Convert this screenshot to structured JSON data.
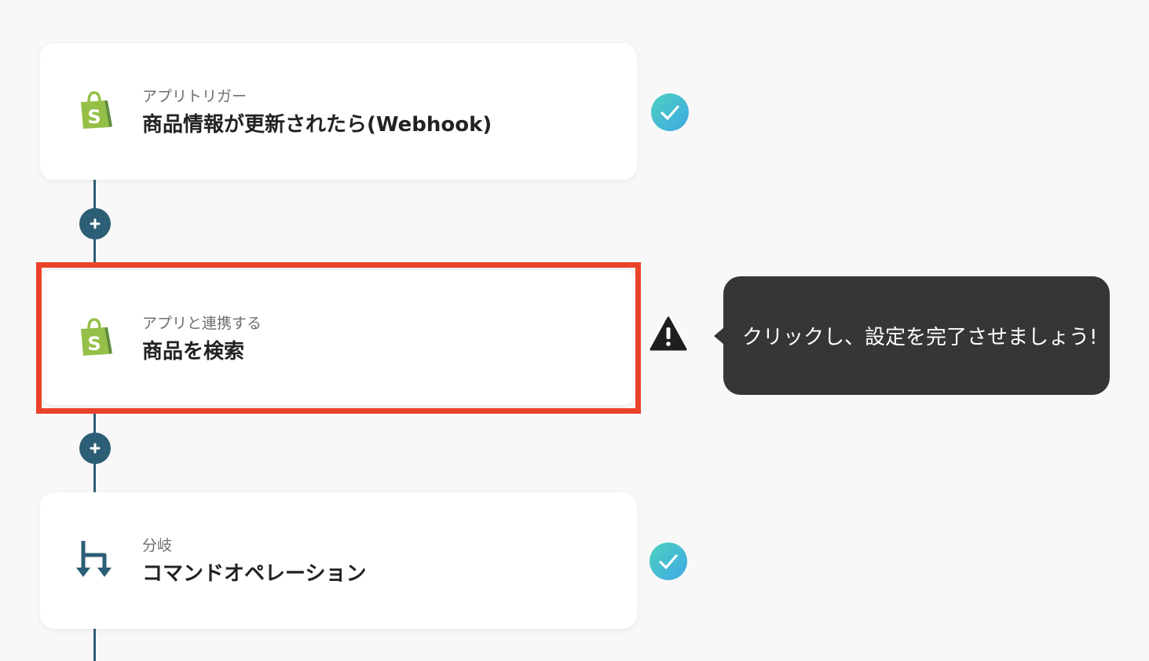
{
  "steps": [
    {
      "subtitle": "アプリトリガー",
      "title": "商品情報が更新されたら(Webhook)",
      "icon": "shopify-icon",
      "status": "complete"
    },
    {
      "subtitle": "アプリと連携する",
      "title": "商品を検索",
      "icon": "shopify-icon",
      "status": "warning",
      "highlighted": true
    },
    {
      "subtitle": "分岐",
      "title": "コマンドオペレーション",
      "icon": "branch-icon",
      "status": "complete"
    }
  ],
  "tooltip": {
    "text": "クリックし、設定を完了させましょう!"
  },
  "colors": {
    "connector": "#2c5e75",
    "highlight": "#ea4228",
    "shopify_green": "#95bf47",
    "shopify_dark": "#5e8e3e",
    "check_gradient_start": "#4cd1c0",
    "check_gradient_end": "#3fa8e4",
    "tooltip_bg": "#363636",
    "background": "#f8f8f8"
  }
}
